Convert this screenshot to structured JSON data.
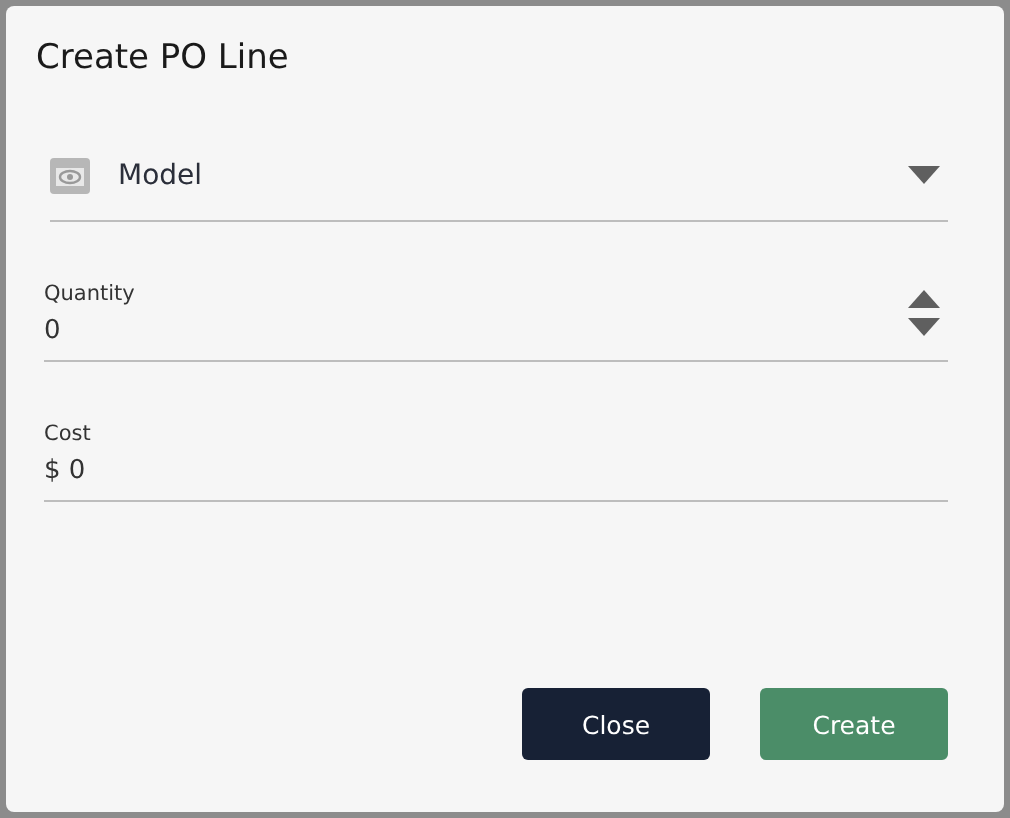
{
  "dialog": {
    "title": "Create PO Line"
  },
  "fields": [
    {
      "kind": "select",
      "label": "Model"
    },
    {
      "kind": "number",
      "label": "Quantity",
      "value": "0"
    },
    {
      "kind": "text",
      "label": "Cost",
      "value": "$ 0"
    }
  ],
  "buttons": [
    {
      "kind": "secondary",
      "label": "Close"
    },
    {
      "kind": "primary",
      "label": "Create"
    }
  ]
}
